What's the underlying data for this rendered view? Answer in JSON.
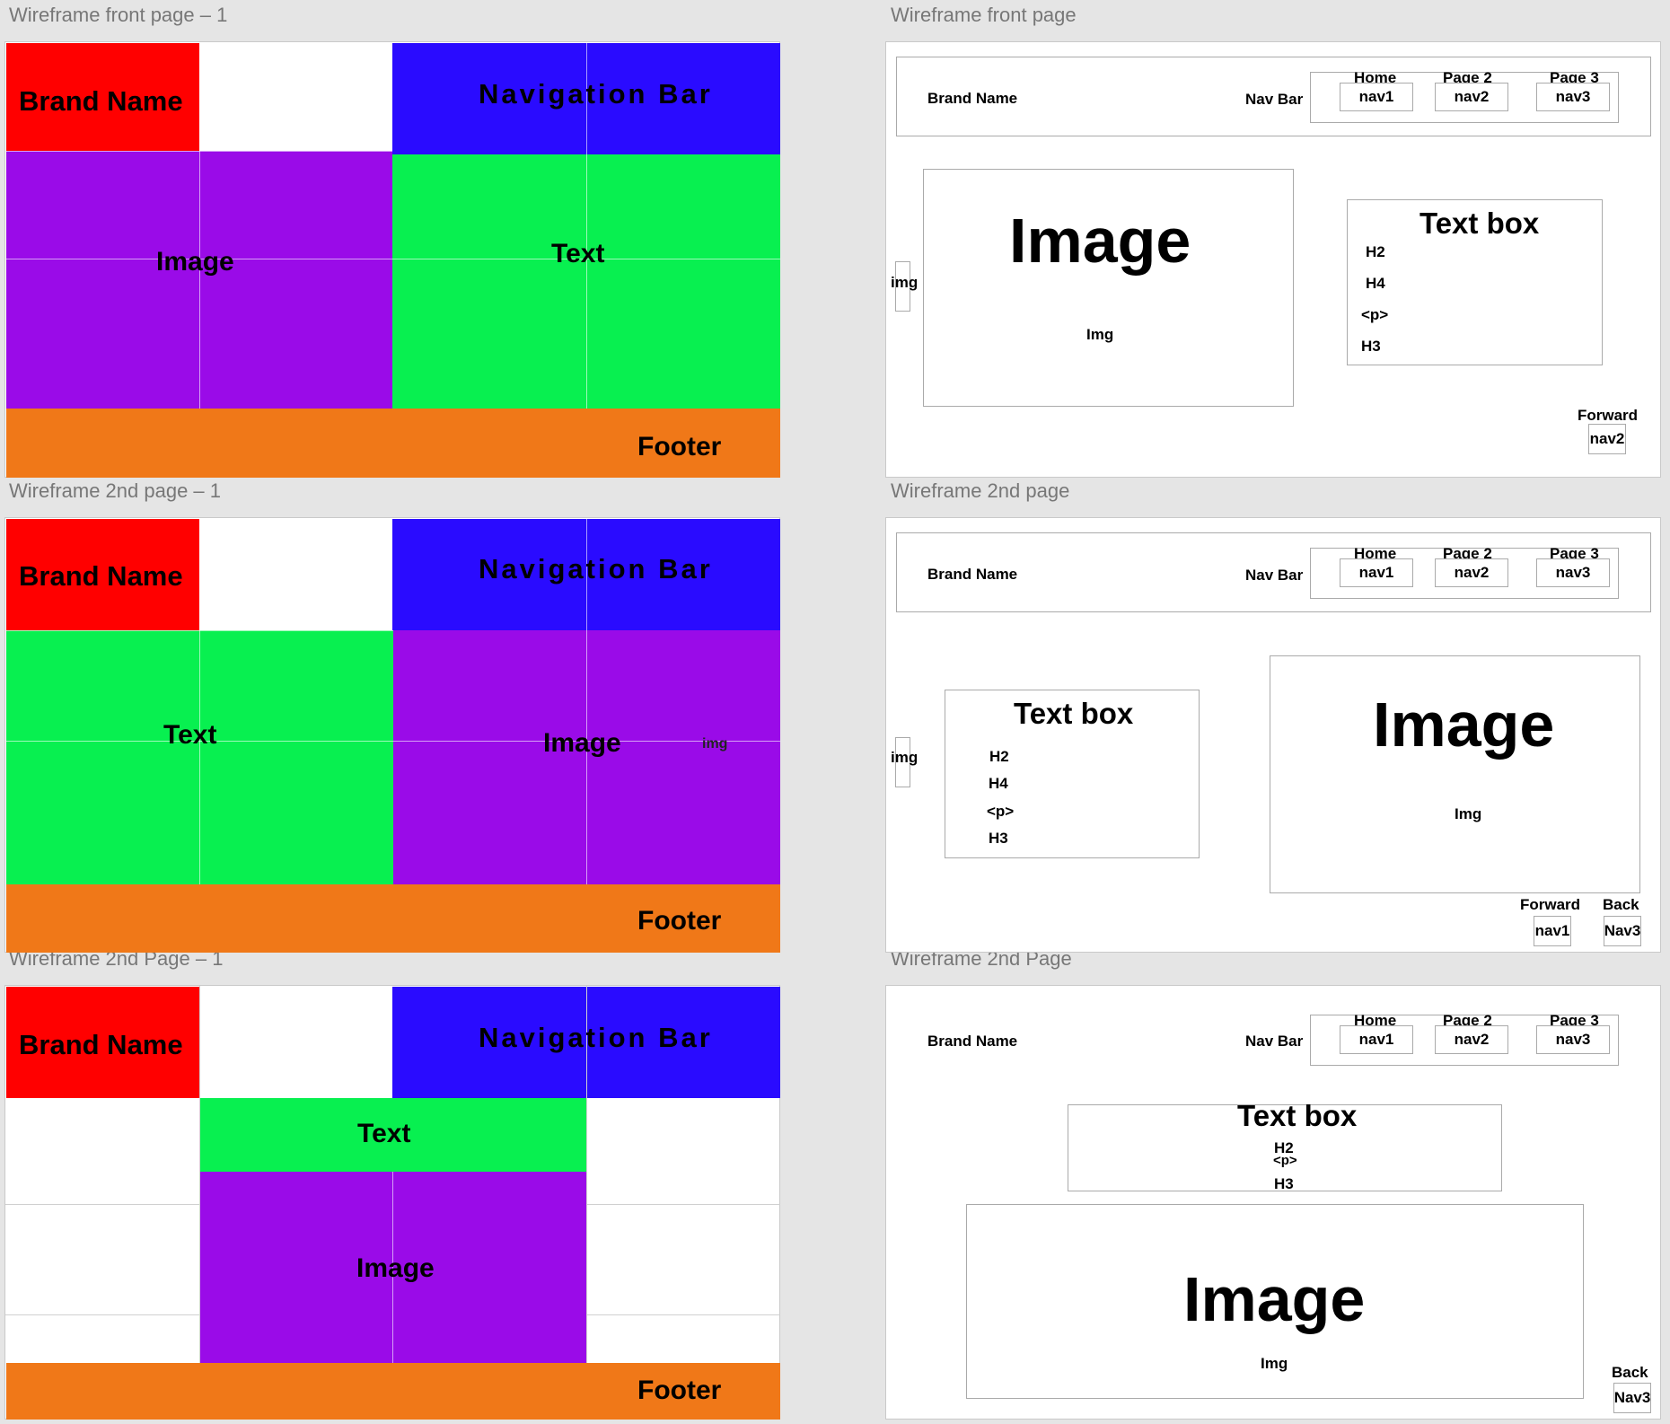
{
  "artboards": {
    "color1": "Wireframe front page – 1",
    "color2": "Wireframe 2nd page – 1",
    "color3": "Wireframe 2nd Page – 1",
    "wire1": "Wireframe front page",
    "wire2": "Wireframe 2nd page",
    "wire3": "Wireframe 2nd Page"
  },
  "color_blocks": {
    "brand": "Brand Name",
    "nav": "Navigation Bar",
    "image": "Image",
    "text": "Text",
    "footer": "Footer",
    "img_small": "img"
  },
  "colors": {
    "brand": "#ff0000",
    "nav": "#2a0bff",
    "image": "#9a0be8",
    "text": "#08f050",
    "footer": "#f07818"
  },
  "wireframe": {
    "brand": "Brand Name",
    "navbar": "Nav Bar",
    "home": "Home",
    "page2": "Page 2",
    "page3": "Page 3",
    "nav1": "nav1",
    "nav2": "nav2",
    "nav3": "nav3",
    "Nav3": "Nav3",
    "image_big": "Image",
    "img_caption": "Img",
    "img_side": "img",
    "textbox": "Text box",
    "h2": "H2",
    "h4": "H4",
    "p": "<p>",
    "h3": "H3",
    "forward": "Forward",
    "back": "Back"
  }
}
